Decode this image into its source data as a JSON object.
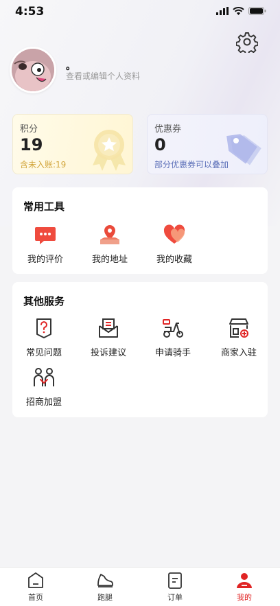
{
  "status_bar": {
    "time": "4:53"
  },
  "profile": {
    "nickname": "。",
    "hint": "查看或编辑个人资料"
  },
  "points": {
    "label": "积分",
    "value": "19",
    "sub": "含未入账:19"
  },
  "coupons": {
    "label": "优惠券",
    "value": "0",
    "sub": "部分优惠券可以叠加"
  },
  "tools": {
    "title": "常用工具",
    "items": [
      {
        "label": "我的评价",
        "icon": "comment-icon"
      },
      {
        "label": "我的地址",
        "icon": "location-icon"
      },
      {
        "label": "我的收藏",
        "icon": "heart-icon"
      }
    ]
  },
  "services": {
    "title": "其他服务",
    "items": [
      {
        "label": "常见问题",
        "icon": "question-icon"
      },
      {
        "label": "投诉建议",
        "icon": "complaint-icon"
      },
      {
        "label": "申请骑手",
        "icon": "scooter-icon"
      },
      {
        "label": "商家入驻",
        "icon": "store-icon"
      },
      {
        "label": "招商加盟",
        "icon": "partner-icon"
      }
    ]
  },
  "tabbar": {
    "items": [
      {
        "label": "首页",
        "icon": "home-icon"
      },
      {
        "label": "跑腿",
        "icon": "shoe-icon"
      },
      {
        "label": "订单",
        "icon": "order-icon"
      },
      {
        "label": "我的",
        "icon": "profile-icon",
        "active": true
      }
    ]
  },
  "colors": {
    "accent": "#e02424",
    "points_text": "#d2a53a",
    "coupon_text": "#5b6fb8"
  }
}
